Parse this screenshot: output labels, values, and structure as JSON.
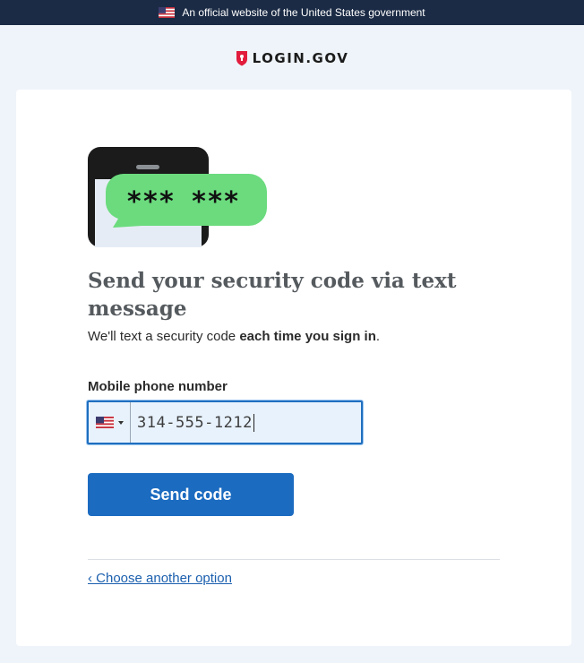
{
  "banner": {
    "text": "An official website of the United States government"
  },
  "brand": {
    "logo_text": "LOGIN.GOV"
  },
  "illustration": {
    "bubble_text": "*** ***"
  },
  "main": {
    "heading": "Send your security code via text message",
    "subtext_prefix": "We'll text a security code ",
    "subtext_bold": "each time you sign in",
    "subtext_suffix": "."
  },
  "phone_field": {
    "label": "Mobile phone number",
    "country": "US",
    "value": "314-555-1212"
  },
  "actions": {
    "send_label": "Send code",
    "back_link": "‹ Choose another option"
  },
  "colors": {
    "banner_bg": "#1b2b45",
    "primary": "#1b6bc0",
    "bubble_green": "#6bdb7e",
    "link": "#1b5fae",
    "logo_red": "#e21c3d"
  }
}
